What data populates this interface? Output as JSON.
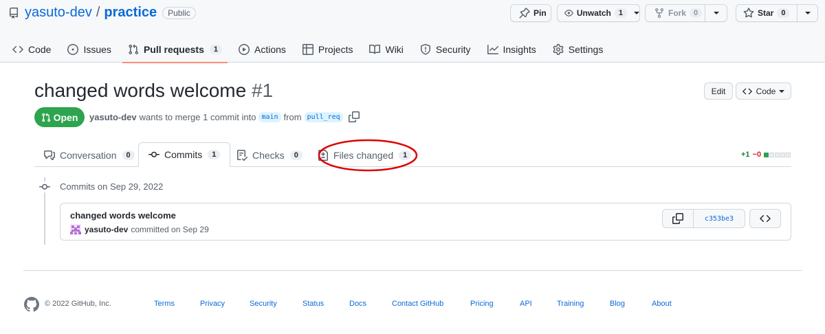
{
  "repo": {
    "owner": "yasuto-dev",
    "separator": "/",
    "name": "practice",
    "visibility": "Public"
  },
  "actions": {
    "pin_label": "Pin",
    "watch_label": "Unwatch",
    "watch_count": "1",
    "fork_label": "Fork",
    "fork_count": "0",
    "star_label": "Star",
    "star_count": "0"
  },
  "nav": {
    "items": [
      {
        "label": "Code",
        "icon": "code-icon"
      },
      {
        "label": "Issues",
        "icon": "issue-icon"
      },
      {
        "label": "Pull requests",
        "icon": "pull-request-icon",
        "count": "1",
        "active": true
      },
      {
        "label": "Actions",
        "icon": "play-icon"
      },
      {
        "label": "Projects",
        "icon": "table-icon"
      },
      {
        "label": "Wiki",
        "icon": "book-icon"
      },
      {
        "label": "Security",
        "icon": "shield-icon"
      },
      {
        "label": "Insights",
        "icon": "graph-icon"
      },
      {
        "label": "Settings",
        "icon": "gear-icon"
      }
    ]
  },
  "pr": {
    "title": "changed words welcome",
    "number": "#1",
    "state": "Open",
    "author": "yasuto-dev",
    "merge_text_1": "wants to merge 1 commit into",
    "base_branch": "main",
    "merge_text_2": "from",
    "head_branch": "pull_req",
    "edit_label": "Edit",
    "code_label": "Code"
  },
  "tabs": [
    {
      "label": "Conversation",
      "count": "0",
      "icon": "comment-discussion-icon"
    },
    {
      "label": "Commits",
      "count": "1",
      "icon": "git-commit-icon",
      "selected": true
    },
    {
      "label": "Checks",
      "count": "0",
      "icon": "checklist-icon"
    },
    {
      "label": "Files changed",
      "count": "1",
      "icon": "file-diff-icon"
    }
  ],
  "diffstat": {
    "additions": "+1",
    "deletions": "−0",
    "boxes": [
      "green",
      "gray",
      "gray",
      "gray",
      "gray"
    ]
  },
  "commits": {
    "date_header": "Commits on Sep 29, 2022",
    "items": [
      {
        "message": "changed words welcome",
        "author": "yasuto-dev",
        "committed_text": "committed on Sep 29",
        "sha": "c353be3"
      }
    ]
  },
  "footer": {
    "copyright": "© 2022 GitHub, Inc.",
    "links": [
      "Terms",
      "Privacy",
      "Security",
      "Status",
      "Docs",
      "Contact GitHub",
      "Pricing",
      "API",
      "Training",
      "Blog",
      "About"
    ]
  },
  "colors": {
    "accent": "#0969da",
    "open_green": "#2da44e",
    "nav_underline": "#fd8c73",
    "annotation_red": "#e00000"
  }
}
